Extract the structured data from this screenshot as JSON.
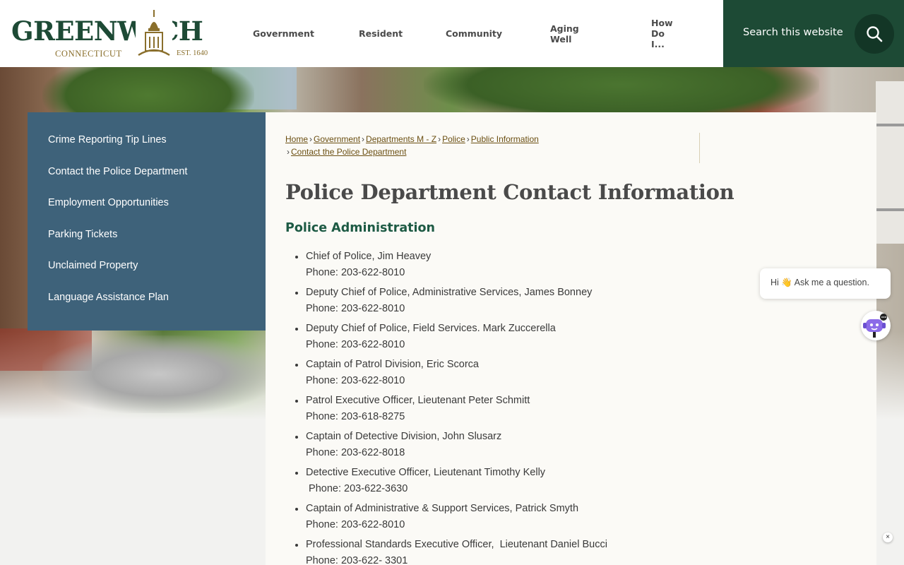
{
  "header": {
    "logo": {
      "word": "GREENWICH",
      "sub": "CONNECTICUT",
      "est": "EST. 1640"
    },
    "nav": [
      "Government",
      "Resident",
      "Community",
      "Aging Well",
      "How Do I..."
    ],
    "search": {
      "placeholder": "Search this website"
    }
  },
  "sidebar": {
    "items": [
      "Crime Reporting Tip Lines",
      "Contact the Police Department",
      "Employment Opportunities",
      "Parking Tickets",
      "Unclaimed Property",
      "Language Assistance Plan"
    ]
  },
  "breadcrumb": [
    "Home",
    "Government",
    "Departments M - Z",
    "Police",
    "Public Information",
    "Contact the Police Department"
  ],
  "main": {
    "title": "Police Department Contact Information",
    "section": "Police Administration",
    "contacts": [
      {
        "name": "Chief of Police, Jim Heavey",
        "phone": "Phone: 203-622-8010"
      },
      {
        "name": "Deputy Chief of Police, Administrative Services, James Bonney",
        "phone": "Phone: 203-622-8010"
      },
      {
        "name": "Deputy Chief of Police, Field Services. Mark Zuccerella",
        "phone": "Phone: 203-622-8010"
      },
      {
        "name": "Captain of Patrol Division, Eric Scorca",
        "phone": "Phone: 203-622-8010"
      },
      {
        "name": "Patrol Executive Officer, Lieutenant Peter Schmitt",
        "phone": "Phone: 203-618-8275"
      },
      {
        "name": "Captain of Detective Division, John Slusarz",
        "phone": "Phone: 203-622-8018"
      },
      {
        "name": "Detective Executive Officer, Lieutenant Timothy Kelly",
        "phone": " Phone: 203-622-3630"
      },
      {
        "name": "Captain of Administrative & Support Services, Patrick Smyth",
        "phone": "Phone: 203-622-8010"
      },
      {
        "name": "Professional Standards Executive Officer,  Lieutenant Daniel Bucci",
        "phone": "Phone: 203-622- 3301"
      }
    ]
  },
  "chat": {
    "message": "Hi 👋 Ask me a question.",
    "close": "×"
  },
  "colors": {
    "brand_green": "#1d4a35",
    "sidebar_blue": "#3e627a",
    "link_brown": "#6b4f12",
    "section_green": "#1d5a44"
  }
}
